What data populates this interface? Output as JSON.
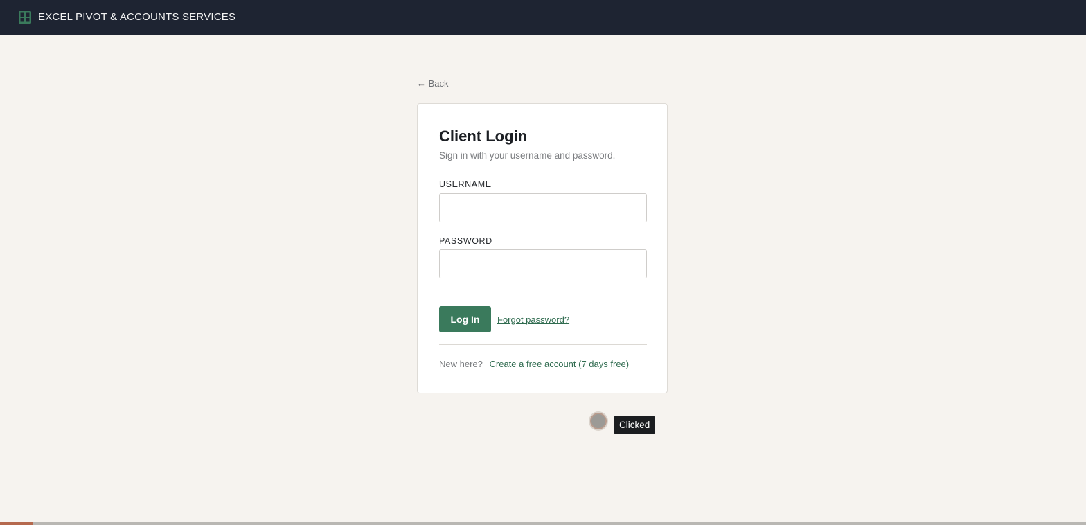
{
  "header": {
    "brand_icon": "spreadsheet-grid-icon",
    "brand_name": "EXCEL PIVOT & ACCOUNTS SERVICES",
    "background_color": "#1e2432",
    "icon_color": "#3a7a5c"
  },
  "nav": {
    "back_label": "← Back"
  },
  "login_card": {
    "title": "Client Login",
    "subtitle": "Sign in with your username and password.",
    "username": {
      "label": "USERNAME",
      "value": "",
      "placeholder": ""
    },
    "password": {
      "label": "PASSWORD",
      "value": "",
      "placeholder": ""
    },
    "login_button_label": "Log In",
    "forgot_password_label": "Forgot password?",
    "new_here_text": "New here?",
    "create_account_label": "Create a free account (7 days free)"
  },
  "overlay": {
    "click_tooltip": "Clicked"
  },
  "progress": {
    "fraction": 0.03
  },
  "colors": {
    "accent": "#3a7a5c",
    "link": "#2f6b4f",
    "page_background": "#f6f3ef",
    "progress_fill": "#b5694e"
  }
}
